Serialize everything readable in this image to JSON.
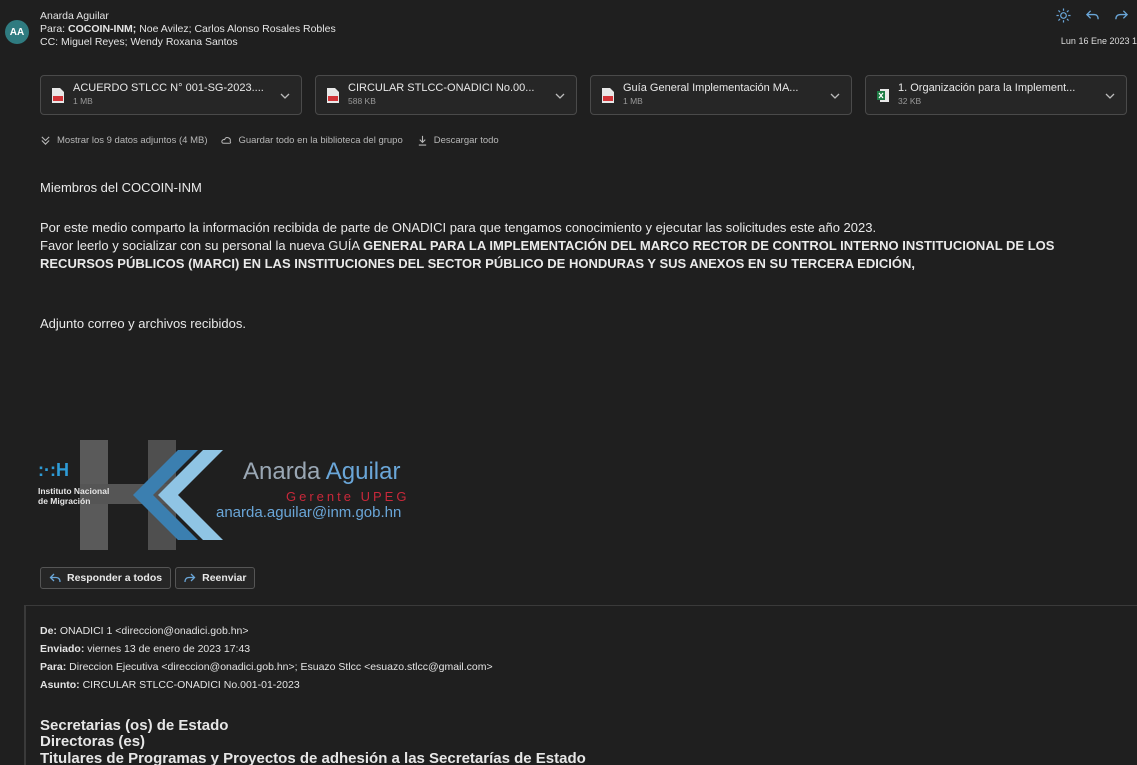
{
  "header": {
    "avatar": "AA",
    "sender": "Anarda Aguilar",
    "to_label": "Para:",
    "to_bold": "COCOIN-INM;",
    "to_rest": " Noe Avilez; Carlos Alonso Rosales Robles",
    "cc": "CC: Miguel Reyes; Wendy Roxana Santos",
    "date": "Lun 16 Ene 2023 1"
  },
  "attachments": [
    {
      "name": "ACUERDO STLCC N° 001-SG-2023....",
      "size": "1 MB",
      "type": "pdf-icon"
    },
    {
      "name": "CIRCULAR STLCC-ONADICI No.00...",
      "size": "588 KB",
      "type": "pdf-icon"
    },
    {
      "name": "Guía General Implementación MA...",
      "size": "1 MB",
      "type": "pdf-icon"
    },
    {
      "name": "1. Organización para la Implement...",
      "size": "32 KB",
      "type": "excel-icon"
    }
  ],
  "attachment_actions": {
    "show_all": "Mostrar los 9 datos adjuntos (4 MB)",
    "save_group": "Guardar todo en la biblioteca del grupo",
    "download_all": "Descargar todo"
  },
  "body": {
    "greeting": "Miembros del COCOIN-INM",
    "line1": "Por este medio comparto la información recibida de parte de ONADICI para que tengamos conocimiento y ejecutar las solicitudes este año 2023.",
    "line2_plain": "Favor leerlo y socializar con su personal la nueva GUÍA ",
    "line2_bold": "GENERAL PARA LA IMPLEMENTACIÓN DEL MARCO RECTOR DE CONTROL INTERNO INSTITUCIONAL DE LOS",
    "line3_bold": "RECURSOS PÚBLICOS (MARCI) EN LAS INSTITUCIONES DEL SECTOR PÚBLICO DE HONDURAS Y SUS ANEXOS EN SU TERCERA EDICIÓN,",
    "line4": "Adjunto correo y archivos recibidos."
  },
  "signature": {
    "logo_mark": ":·:H",
    "inst1": "Instituto Nacional",
    "inst2": "de Migración",
    "name_first": "Anarda ",
    "name_last": "Aguilar",
    "role": "Gerente UPEG",
    "email": "anarda.aguilar@inm.gob.hn"
  },
  "actions": {
    "reply_all": "Responder a todos",
    "forward": "Reenviar"
  },
  "forwarded": {
    "from_label": "De:",
    "from": " ONADICI 1 <direccion@onadici.gob.hn>",
    "sent_label": "Enviado:",
    "sent": " viernes 13 de enero de 2023 17:43",
    "to_label": "Para:",
    "to": " Direccion Ejecutiva <direccion@onadici.gob.hn>; Esuazo Stlcc <esuazo.stlcc@gmail.com>",
    "subject_label": "Asunto:",
    "subject": " CIRCULAR STLCC-ONADICI No.001-01-2023",
    "big1": "Secretarias (os) de Estado",
    "big2": "Directoras (es)",
    "big3": "Titulares de Programas y Proyectos de adhesión a las Secretarías de Estado"
  }
}
